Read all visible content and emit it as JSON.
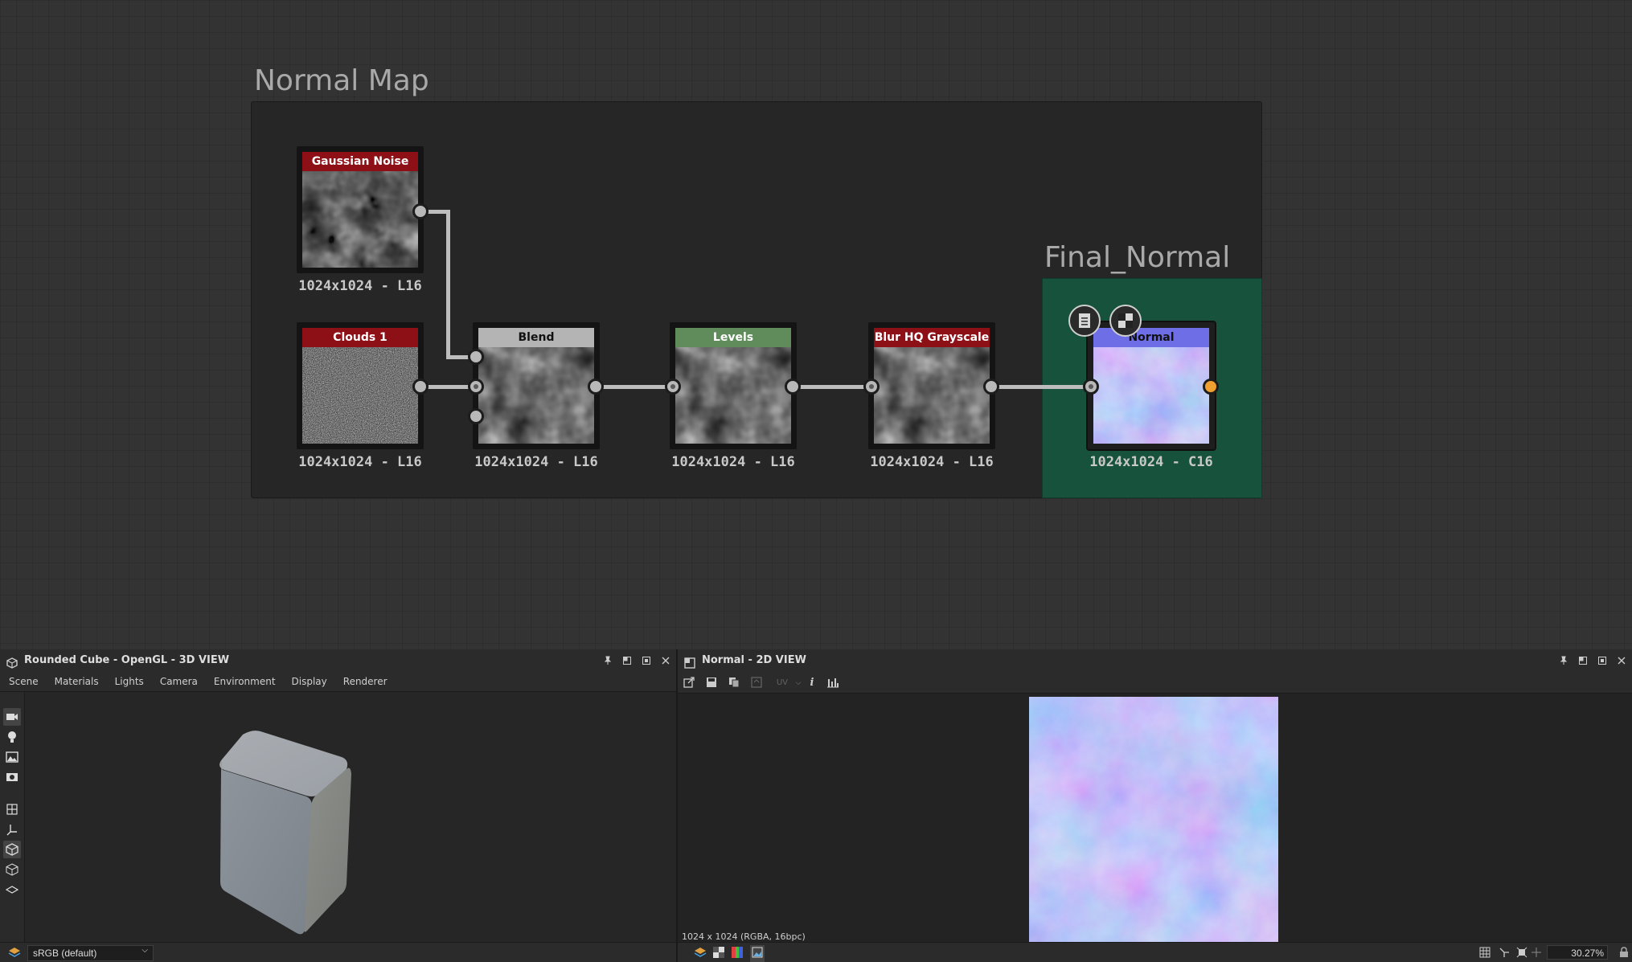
{
  "graph": {
    "frames": {
      "main_title": "Normal Map",
      "final_title": "Final_Normal"
    },
    "nodes": [
      {
        "id": "gaussian",
        "label": "Gaussian Noise",
        "resolution": "1024x1024 - L16",
        "header_color": "#8c1016"
      },
      {
        "id": "clouds",
        "label": "Clouds 1",
        "resolution": "1024x1024 - L16",
        "header_color": "#8c1016"
      },
      {
        "id": "blend",
        "label": "Blend",
        "resolution": "1024x1024 - L16",
        "header_color": "#b4b4b4"
      },
      {
        "id": "levels",
        "label": "Levels",
        "resolution": "1024x1024 - L16",
        "header_color": "#5f8c5a"
      },
      {
        "id": "blur",
        "label": "Blur HQ Grayscale",
        "resolution": "1024x1024 - L16",
        "header_color": "#8c1016"
      },
      {
        "id": "normal",
        "label": "Normal",
        "resolution": "1024x1024 - C16",
        "header_color": "#6e6ee6"
      }
    ]
  },
  "panel3d": {
    "title": "Rounded Cube - OpenGL - 3D VIEW",
    "menu": [
      "Scene",
      "Materials",
      "Lights",
      "Camera",
      "Environment",
      "Display",
      "Renderer"
    ],
    "colorspace": "sRGB (default)",
    "side_icons": [
      "camera-icon",
      "light-icon",
      "environment-icon",
      "render-icon",
      "grid-icon",
      "axis-icon",
      "cube-icon",
      "wireframe-cube-icon",
      "plane-icon"
    ]
  },
  "panel2d": {
    "title": "Normal - 2D VIEW",
    "toolbar": {
      "uv_label": "UV",
      "info_label": "i"
    },
    "image_info": "1024 x 1024 (RGBA, 16bpc)",
    "zoom": "30.27%"
  },
  "colors": {
    "graph_bg": "#333333",
    "frame_bg": "#262626",
    "final_frame_bg": "#17533c",
    "output_port": "#f0a030"
  }
}
